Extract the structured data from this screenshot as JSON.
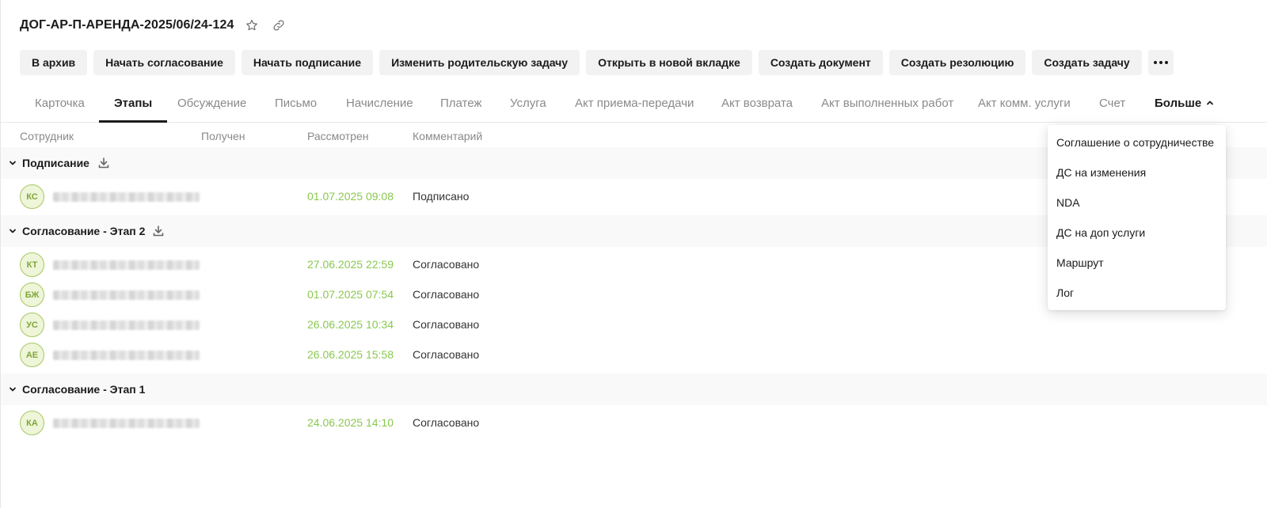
{
  "header": {
    "title": "ДОГ-АР-П-АРЕНДА-2025/06/24-124",
    "favorite_icon": "star-icon",
    "link_icon": "link-icon"
  },
  "actions": [
    {
      "label": "В архив"
    },
    {
      "label": "Начать согласование"
    },
    {
      "label": "Начать подписание"
    },
    {
      "label": "Изменить родительскую задачу"
    },
    {
      "label": "Открыть в новой вкладке"
    },
    {
      "label": "Создать документ"
    },
    {
      "label": "Создать резолюцию"
    },
    {
      "label": "Создать задачу"
    }
  ],
  "tabs": [
    {
      "label": "Карточка"
    },
    {
      "label": "Этапы"
    },
    {
      "label": "Обсуждение"
    },
    {
      "label": "Письмо"
    },
    {
      "label": "Начисление"
    },
    {
      "label": "Платеж"
    },
    {
      "label": "Услуга"
    },
    {
      "label": "Акт приема-передачи"
    },
    {
      "label": "Акт возврата"
    },
    {
      "label": "Акт выполненных работ"
    },
    {
      "label": "Акт комм. услуги"
    },
    {
      "label": "Счет"
    },
    {
      "label": "Больше"
    }
  ],
  "active_tab": "Этапы",
  "columns": {
    "employee": "Сотрудник",
    "received": "Получен",
    "reviewed": "Рассмотрен",
    "comment": "Комментарий"
  },
  "groups": [
    {
      "title": "Подписание",
      "rows": [
        {
          "initials": "КС",
          "reviewed": "01.07.2025 09:08",
          "comment": "Подписано"
        }
      ]
    },
    {
      "title": "Согласование - Этап 2",
      "rows": [
        {
          "initials": "КТ",
          "reviewed": "27.06.2025 22:59",
          "comment": "Согласовано"
        },
        {
          "initials": "БЖ",
          "reviewed": "01.07.2025 07:54",
          "comment": "Согласовано"
        },
        {
          "initials": "УС",
          "reviewed": "26.06.2025 10:34",
          "comment": "Согласовано"
        },
        {
          "initials": "АЕ",
          "reviewed": "26.06.2025 15:58",
          "comment": "Согласовано"
        }
      ]
    },
    {
      "title": "Согласование - Этап 1",
      "rows": [
        {
          "initials": "КА",
          "reviewed": "24.06.2025 14:10",
          "comment": "Согласовано"
        }
      ]
    }
  ],
  "dropdown": {
    "items": [
      {
        "label": "Соглашение о сотрудничестве"
      },
      {
        "label": "ДС на изменения"
      },
      {
        "label": "NDA"
      },
      {
        "label": "ДС на доп услуги"
      },
      {
        "label": "Маршрут"
      },
      {
        "label": "Лог"
      }
    ]
  },
  "colors": {
    "accent_green": "#8ac850",
    "avatar_bg": "#eef5d8",
    "avatar_border": "#a6c764",
    "button_bg": "#f2f2f2"
  }
}
